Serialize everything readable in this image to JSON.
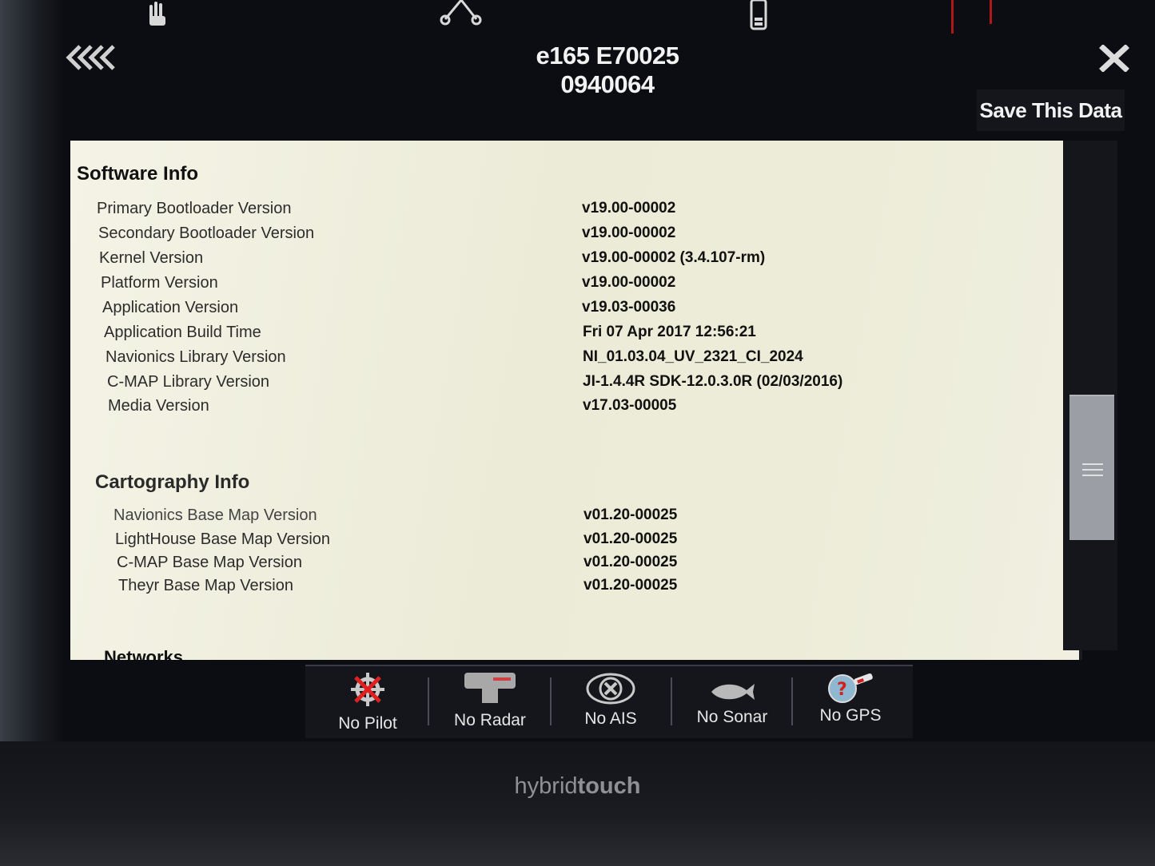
{
  "window": {
    "title": "e165 E70025 0940064",
    "save_label": "Save This Data"
  },
  "software": {
    "heading": "Software Info",
    "rows": [
      {
        "label": "Primary Bootloader Version",
        "value": "v19.00-00002"
      },
      {
        "label": "Secondary Bootloader Version",
        "value": "v19.00-00002"
      },
      {
        "label": "Kernel Version",
        "value": "v19.00-00002 (3.4.107-rm)"
      },
      {
        "label": "Platform Version",
        "value": "v19.00-00002"
      },
      {
        "label": "Application Version",
        "value": "v19.03-00036"
      },
      {
        "label": "Application Build Time",
        "value": "Fri 07 Apr 2017 12:56:21"
      },
      {
        "label": "Navionics Library Version",
        "value": "NI_01.03.04_UV_2321_CI_2024"
      },
      {
        "label": "C-MAP Library Version",
        "value": "JI-1.4.4R SDK-12.0.3.0R (02/03/2016)"
      },
      {
        "label": "Media Version",
        "value": "v17.03-00005"
      }
    ]
  },
  "cartography": {
    "heading": "Cartography Info",
    "rows": [
      {
        "label": "Navionics Base Map Version",
        "value": "v01.20-00025"
      },
      {
        "label": "LightHouse Base Map Version",
        "value": "v01.20-00025"
      },
      {
        "label": "C-MAP Base Map Version",
        "value": "v01.20-00025"
      },
      {
        "label": "Theyr Base Map Version",
        "value": "v01.20-00025"
      }
    ]
  },
  "networks": {
    "heading": "Networks"
  },
  "status_bar": [
    {
      "label": "No Pilot",
      "icon": "pilot-icon"
    },
    {
      "label": "No Radar",
      "icon": "radar-icon"
    },
    {
      "label": "No AIS",
      "icon": "ais-icon"
    },
    {
      "label": "No Sonar",
      "icon": "sonar-icon"
    },
    {
      "label": "No GPS",
      "icon": "gps-icon"
    }
  ],
  "brand": {
    "part1": "hybrid",
    "part2": "touch"
  },
  "colors": {
    "panel_bg": "#eeedda",
    "chrome_bg": "#15161b",
    "text_light": "#f2f2f2"
  }
}
